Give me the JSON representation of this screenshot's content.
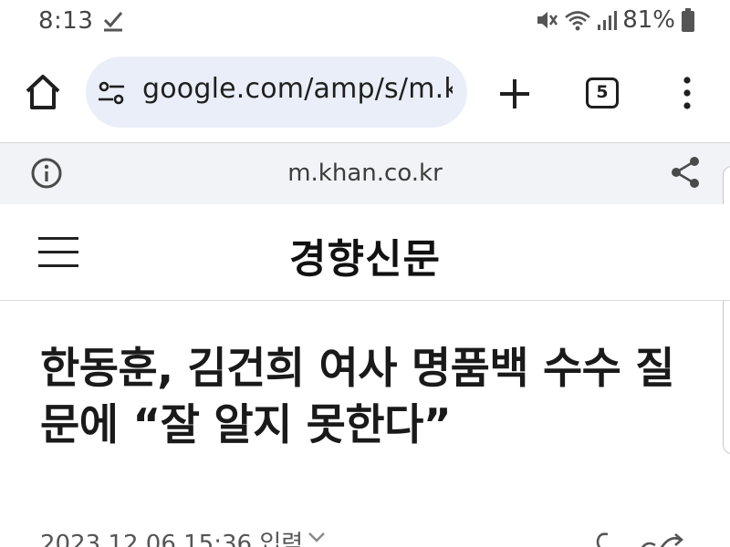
{
  "status_bar": {
    "time": "8:13",
    "battery_percent": "81%",
    "icons": [
      "check-icon",
      "mute-icon",
      "wifi-icon",
      "signal-icon",
      "battery-icon"
    ]
  },
  "browser": {
    "url": "google.com/amp/s/m.khan.co.kr",
    "tab_count": "5",
    "site_domain": "m.khan.co.kr",
    "accent_color": "#e9eef8"
  },
  "site": {
    "logo": "경향신문"
  },
  "article": {
    "headline": "한동훈, 김건희 여사 명품백 수수 질문에 “잘 알지 못한다”",
    "datetime": "2023.12.06 15:36 입력"
  }
}
